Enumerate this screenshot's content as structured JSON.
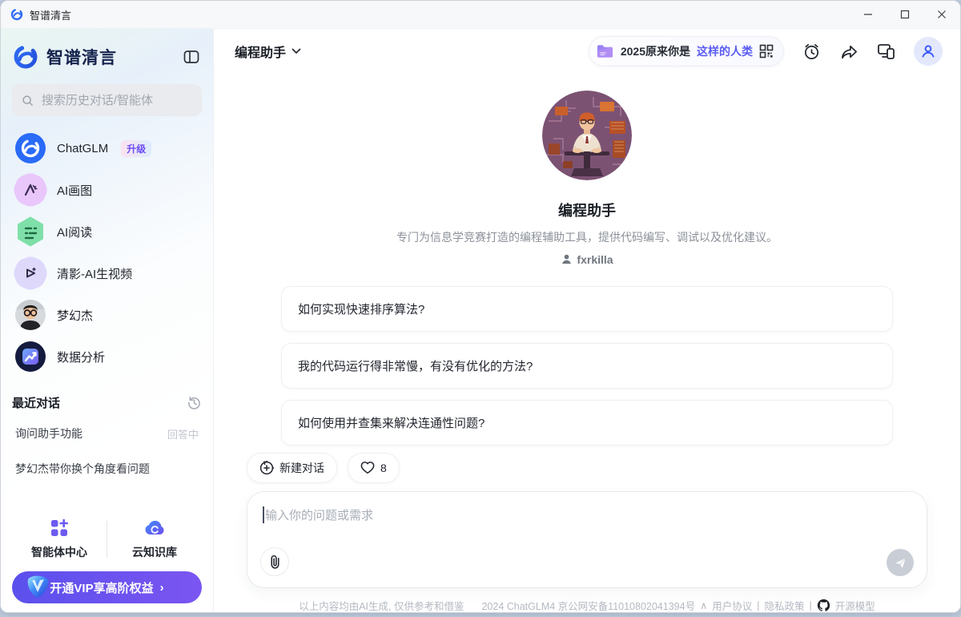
{
  "titlebar": {
    "app_title": "智谱清言"
  },
  "sidebar": {
    "brand": "智谱清言",
    "search_placeholder": "搜索历史对话/智能体",
    "items": [
      {
        "label": "ChatGLM",
        "badge": "升级"
      },
      {
        "label": "AI画图"
      },
      {
        "label": "AI阅读"
      },
      {
        "label": "清影-AI生视频"
      },
      {
        "label": "梦幻杰"
      },
      {
        "label": "数据分析"
      }
    ],
    "recent": {
      "header": "最近对话",
      "items": [
        {
          "title": "询问助手功能",
          "status": "回答中"
        },
        {
          "title": "梦幻杰带你换个角度看问题",
          "status": ""
        }
      ]
    },
    "tabs": {
      "agent_center": "智能体中心",
      "cloud_kb": "云知识库"
    },
    "vip_label": "开通VIP享高阶权益",
    "vip_chevron": "›"
  },
  "header": {
    "agent_name": "编程助手",
    "banner": {
      "text_plain": "2025原来你是",
      "text_highlight": "这样的人类"
    }
  },
  "main": {
    "agent_title": "编程助手",
    "agent_desc": "专门为信息学竞赛打造的编程辅助工具，提供代码编写、调试以及优化建议。",
    "agent_author": "fxrkilla",
    "suggestions": [
      {
        "text": "如何实现快速排序算法?"
      },
      {
        "text": "我的代码运行得非常慢，有没有优化的方法?"
      },
      {
        "text": "如何使用并查集来解决连通性问题?"
      }
    ],
    "new_chat_label": "新建对话",
    "likes_count": "8",
    "input_placeholder": "输入你的问题或需求"
  },
  "footer": {
    "disclaimer": "以上内容均由AI生成, 仅供参考和借鉴",
    "copyright": "2024 ChatGLM4 京公网安备11010802041394号",
    "caret": "∧",
    "terms": "用户协议",
    "sep1": "|",
    "privacy": "隐私政策",
    "sep2": "|",
    "opensource": "开源模型"
  },
  "colors": {
    "accent": "#3b5bfd",
    "vip_start": "#5b50ec",
    "vip_end": "#7b55f1",
    "brand_navy": "#15234d"
  }
}
